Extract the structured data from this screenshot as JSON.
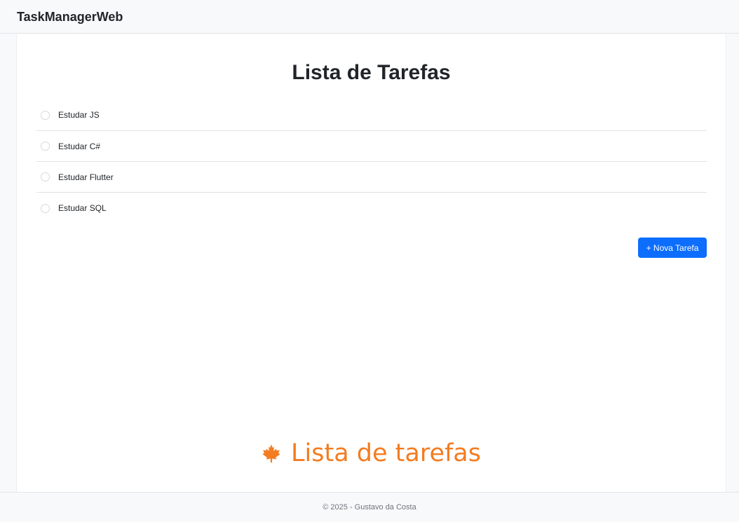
{
  "navbar": {
    "brand": "TaskManagerWeb"
  },
  "main": {
    "title": "Lista de Tarefas",
    "tasks": [
      {
        "label": "Estudar JS",
        "checked": false
      },
      {
        "label": "Estudar C#",
        "checked": false
      },
      {
        "label": "Estudar Flutter",
        "checked": false
      },
      {
        "label": "Estudar SQL",
        "checked": false
      }
    ],
    "new_task_button": "+ Nova Tarefa"
  },
  "logo": {
    "icon": "maple-leaf-icon",
    "text": "Lista de tarefas",
    "color": "#f47c20"
  },
  "footer": {
    "text": "© 2025 - Gustavo da Costa"
  },
  "colors": {
    "primary": "#0d6efd",
    "accent": "#f47c20"
  }
}
